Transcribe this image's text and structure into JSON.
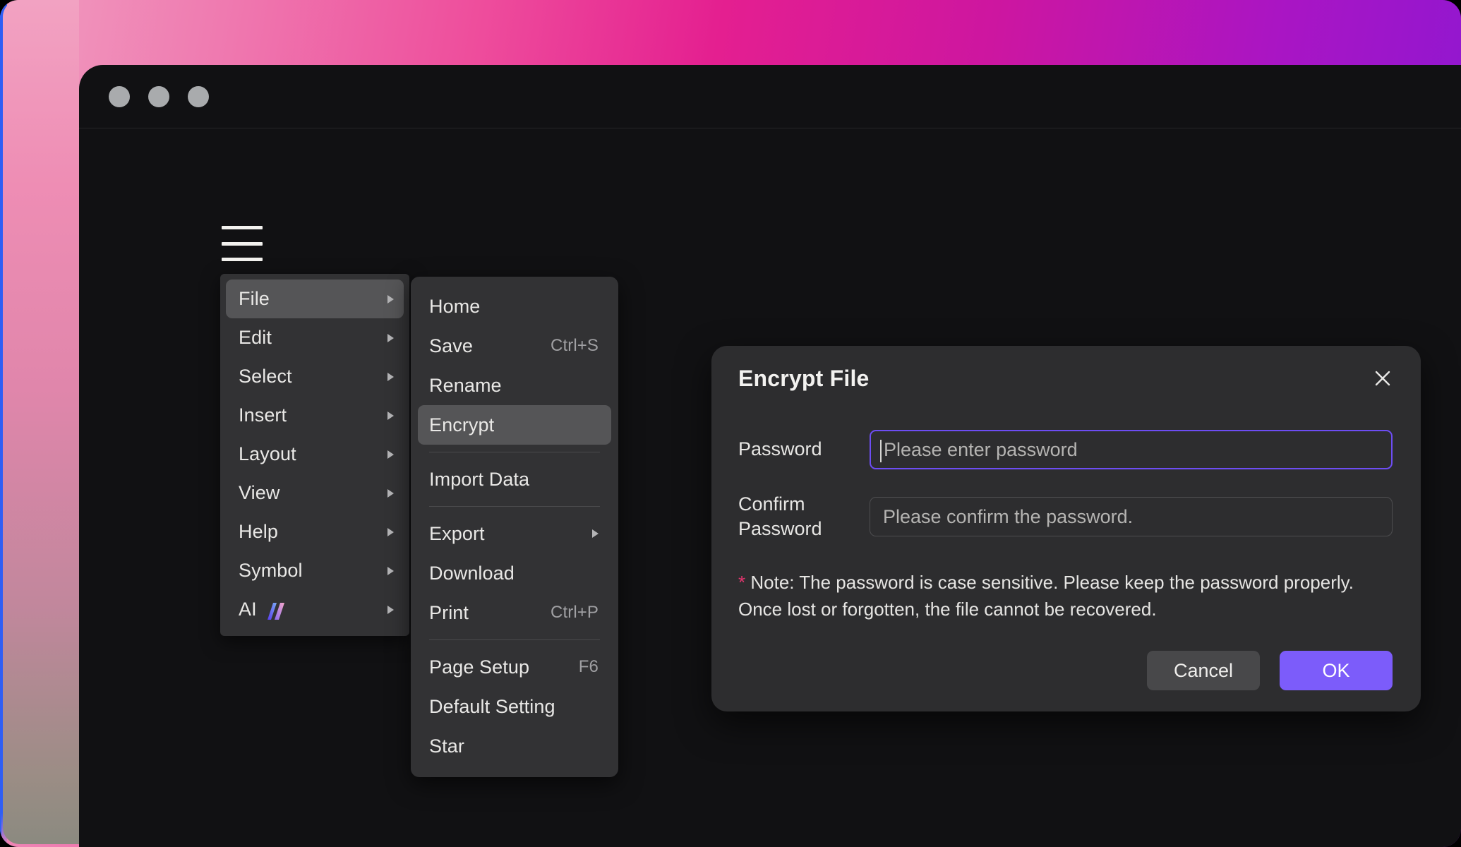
{
  "background": {
    "gradient_from": "#f09ec0",
    "gradient_mid": "#e41f90",
    "gradient_to": "#8a18d2",
    "edge_accent_color": "#2f5ef5"
  },
  "window": {
    "traffic_lights": [
      "close-dot",
      "minimize-dot",
      "maximize-dot"
    ],
    "traffic_light_color": "#a9abad",
    "menu_button": "hamburger-menu"
  },
  "menu_level1": {
    "items": [
      {
        "label": "File",
        "has_submenu": true,
        "active": true
      },
      {
        "label": "Edit",
        "has_submenu": true,
        "active": false
      },
      {
        "label": "Select",
        "has_submenu": true,
        "active": false
      },
      {
        "label": "Insert",
        "has_submenu": true,
        "active": false
      },
      {
        "label": "Layout",
        "has_submenu": true,
        "active": false
      },
      {
        "label": "View",
        "has_submenu": true,
        "active": false
      },
      {
        "label": "Help",
        "has_submenu": true,
        "active": false
      },
      {
        "label": "Symbol",
        "has_submenu": true,
        "active": false
      },
      {
        "label": "AI",
        "has_submenu": true,
        "active": false,
        "icon": "ai-sparkle-icon"
      }
    ]
  },
  "menu_level2": {
    "items": [
      {
        "label": "Home",
        "shortcut": "",
        "has_submenu": false,
        "active": false
      },
      {
        "label": "Save",
        "shortcut": "Ctrl+S",
        "has_submenu": false,
        "active": false
      },
      {
        "label": "Rename",
        "shortcut": "",
        "has_submenu": false,
        "active": false
      },
      {
        "label": "Encrypt",
        "shortcut": "",
        "has_submenu": false,
        "active": true
      },
      {
        "separator": true
      },
      {
        "label": "Import Data",
        "shortcut": "",
        "has_submenu": false,
        "active": false
      },
      {
        "separator": true
      },
      {
        "label": "Export",
        "shortcut": "",
        "has_submenu": true,
        "active": false
      },
      {
        "label": "Download",
        "shortcut": "",
        "has_submenu": false,
        "active": false
      },
      {
        "label": "Print",
        "shortcut": "Ctrl+P",
        "has_submenu": false,
        "active": false
      },
      {
        "separator": true
      },
      {
        "label": "Page Setup",
        "shortcut": "F6",
        "has_submenu": false,
        "active": false
      },
      {
        "label": "Default Setting",
        "shortcut": "",
        "has_submenu": false,
        "active": false
      },
      {
        "label": "Star",
        "shortcut": "",
        "has_submenu": false,
        "active": false
      }
    ]
  },
  "dialog": {
    "title": "Encrypt File",
    "close_icon": "close-icon",
    "password": {
      "label": "Password",
      "value": "",
      "placeholder": "Please enter password",
      "focused": true,
      "focus_color": "#6d4df3"
    },
    "confirm": {
      "label": "Confirm Password",
      "label_line1": "Confirm",
      "label_line2": "Password",
      "value": "",
      "placeholder": "Please confirm the password.",
      "focused": false
    },
    "note_marker": "*",
    "note_marker_color": "#e4356f",
    "note": "Note: The password is case sensitive. Please keep the password properly. Once lost or forgotten, the file cannot be recovered.",
    "cancel_label": "Cancel",
    "ok_label": "OK",
    "ok_color": "#7c5cfa"
  }
}
